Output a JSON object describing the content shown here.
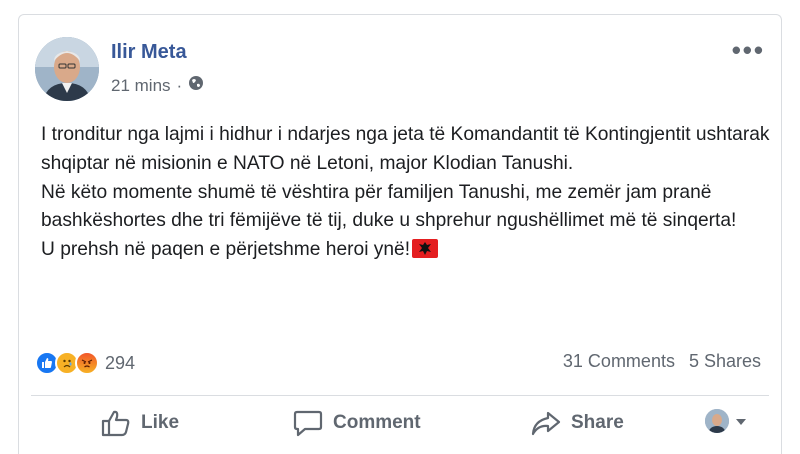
{
  "post": {
    "author": "Ilir Meta",
    "time": "21 mins",
    "separator": "·",
    "audience_icon": "globe-icon",
    "more_icon": "more-icon",
    "paragraphs": [
      "I tronditur nga lajmi i hidhur i ndarjes nga jeta të Komandantit të Kontingjentit ushtarak shqiptar në misionin e NATO në Letoni, major Klodian Tanushi.",
      "Në këto momente shumë të vështira për familjen Tanushi, me zemër jam pranë bashkëshortes dhe tri fëmijëve të tij, duke u shprehur ngushëllimet më të sinqerta!",
      "U prehsh në paqen e përjetshme heroi ynë!"
    ]
  },
  "footer": {
    "reaction_icons": [
      "like-icon",
      "sad-icon",
      "angry-icon"
    ],
    "reaction_count": "294",
    "comments": "31 Comments",
    "shares": "5 Shares"
  },
  "actions": {
    "like": "Like",
    "comment": "Comment",
    "share": "Share"
  },
  "colors": {
    "author": "#385898",
    "text": "#1c1e21",
    "muted": "#606770",
    "like_blue": "#1877f2",
    "flag_red": "#e41e20"
  }
}
